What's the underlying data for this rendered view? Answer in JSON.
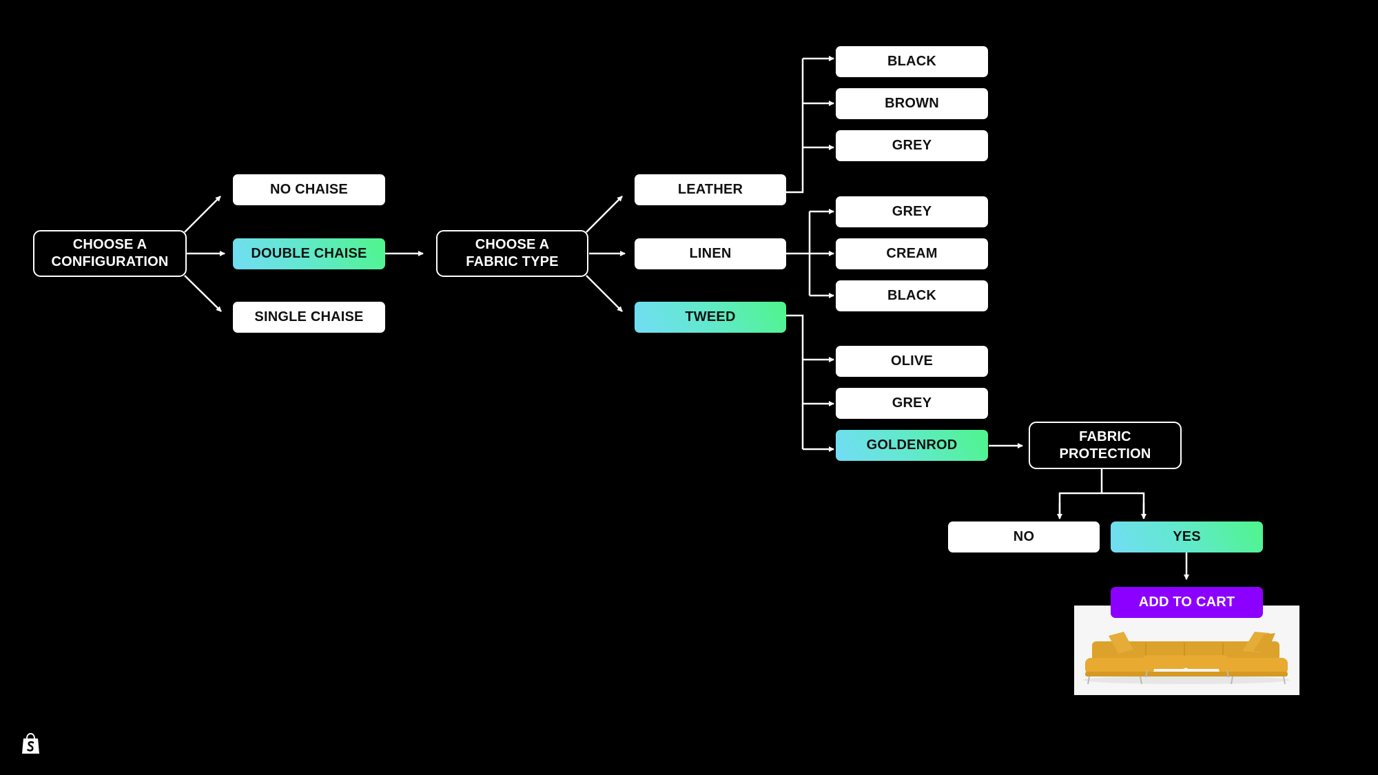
{
  "diagram": {
    "step1": {
      "label": "CHOOSE A\nCONFIGURATION"
    },
    "configurations": [
      {
        "label": "NO CHAISE",
        "selected": false
      },
      {
        "label": "DOUBLE CHAISE",
        "selected": true
      },
      {
        "label": "SINGLE CHAISE",
        "selected": false
      }
    ],
    "step2": {
      "label": "CHOOSE A\nFABRIC TYPE"
    },
    "fabrics": [
      {
        "label": "LEATHER",
        "selected": false,
        "colors": [
          "BLACK",
          "BROWN",
          "GREY"
        ]
      },
      {
        "label": "LINEN",
        "selected": false,
        "colors": [
          "GREY",
          "CREAM",
          "BLACK"
        ]
      },
      {
        "label": "TWEED",
        "selected": true,
        "colors": [
          "OLIVE",
          "GREY",
          "GOLDENROD"
        ],
        "selected_color": "GOLDENROD"
      }
    ],
    "step3": {
      "label": "FABRIC\nPROTECTION"
    },
    "protection_options": [
      {
        "label": "NO",
        "selected": false
      },
      {
        "label": "YES",
        "selected": true
      }
    ],
    "cta": {
      "label": "ADD TO CART"
    },
    "product_image": {
      "icon": "sofa-image",
      "color": "goldenrod"
    }
  },
  "colors": {
    "background": "#000000",
    "option": "#ffffff",
    "selected_gradient_start": "#72dcf5",
    "selected_gradient_end": "#4ff58a",
    "cta": "#8c00ff",
    "product": "#e8aa30"
  },
  "branding": {
    "logo": "shopify-bag-icon"
  }
}
